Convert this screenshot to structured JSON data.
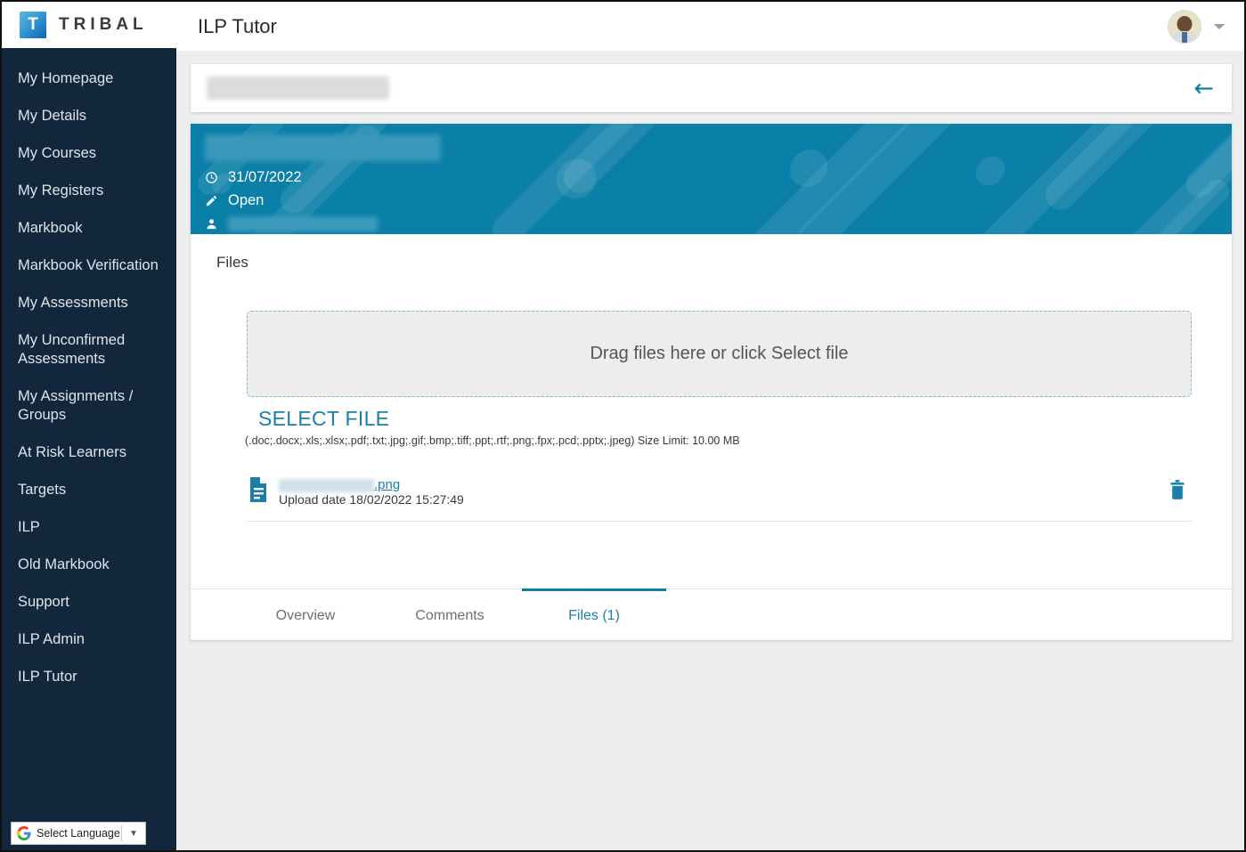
{
  "brand": {
    "logo_letter": "T",
    "logo_word": "TRIBAL",
    "app_title": "ILP Tutor"
  },
  "colors": {
    "sidebar_bg": "#12263c",
    "banner_bg": "#0a7fa8",
    "accent": "#1b7fa8",
    "page_bg": "#eeeeee"
  },
  "sidebar": {
    "items": [
      {
        "label": "My Homepage"
      },
      {
        "label": "My Details"
      },
      {
        "label": "My Courses"
      },
      {
        "label": "My Registers"
      },
      {
        "label": "Markbook"
      },
      {
        "label": "Markbook Verification"
      },
      {
        "label": "My Assessments"
      },
      {
        "label": "My Unconfirmed Assessments"
      },
      {
        "label": "My Assignments / Groups"
      },
      {
        "label": "At Risk Learners"
      },
      {
        "label": "Targets"
      },
      {
        "label": "ILP"
      },
      {
        "label": "Old Markbook"
      },
      {
        "label": "Support"
      },
      {
        "label": "ILP Admin"
      },
      {
        "label": "ILP Tutor"
      }
    ],
    "translate": {
      "label": "Select Language",
      "caret": "▼",
      "icon": "google-g-icon"
    }
  },
  "header_card": {
    "title_redacted": true,
    "back_arrow": "←"
  },
  "banner": {
    "title_redacted": true,
    "date": "31/07/2022",
    "status": "Open",
    "person_redacted": true,
    "icons": {
      "date": "clock-icon",
      "status": "pencil-icon",
      "person": "person-icon"
    }
  },
  "files_panel": {
    "heading": "Files",
    "dropzone_text": "Drag files here or click Select file",
    "select_file_label": "SELECT FILE",
    "file_types": "(.doc;.docx;.xls;.xlsx;.pdf;.txt;.jpg;.gif;.bmp;.tiff;.ppt;.rtf;.png;.fpx;.pcd;.pptx;.jpeg) Size Limit: 10.00 MB",
    "file": {
      "name_redacted": true,
      "extension": ".png",
      "upload_date": "Upload date 18/02/2022 15:27:49",
      "icon": "document-icon",
      "delete_icon": "trash-icon"
    }
  },
  "tabs": [
    {
      "label": "Overview",
      "active": false
    },
    {
      "label": "Comments",
      "active": false
    },
    {
      "label": "Files (1)",
      "active": true
    }
  ],
  "user_menu": {
    "avatar": "user-avatar",
    "caret": "chevron-down-icon"
  }
}
